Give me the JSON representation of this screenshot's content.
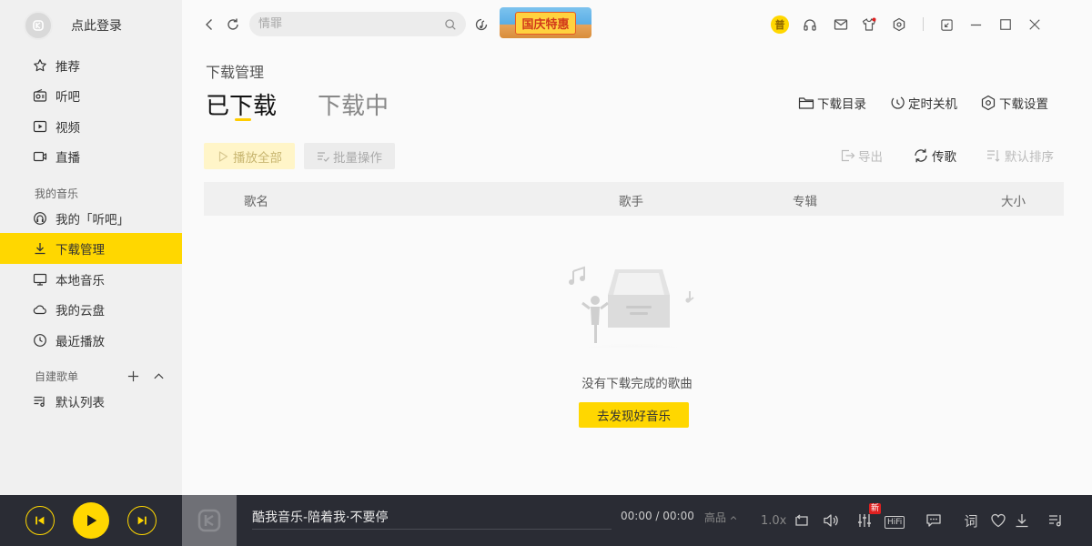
{
  "sidebar": {
    "login_text": "点此登录",
    "nav": [
      {
        "label": "推荐",
        "icon": "star-icon"
      },
      {
        "label": "听吧",
        "icon": "radio-icon"
      },
      {
        "label": "视频",
        "icon": "video-icon"
      },
      {
        "label": "直播",
        "icon": "camera-icon"
      }
    ],
    "my_music_label": "我的音乐",
    "my_music": [
      {
        "label": "我的「听吧」",
        "icon": "headset-icon"
      },
      {
        "label": "下载管理",
        "icon": "download-icon",
        "active": true
      },
      {
        "label": "本地音乐",
        "icon": "monitor-icon"
      },
      {
        "label": "我的云盘",
        "icon": "cloud-icon"
      },
      {
        "label": "最近播放",
        "icon": "clock-icon"
      }
    ],
    "playlists_label": "自建歌单",
    "playlists": [
      {
        "label": "默认列表",
        "icon": "playlist-icon"
      }
    ]
  },
  "topbar": {
    "search_placeholder": "情罪",
    "promo_text": "国庆特惠",
    "vip_text": "普"
  },
  "main": {
    "page_title": "下载管理",
    "tabs": [
      {
        "label": "已下载",
        "active": true
      },
      {
        "label": "下载中",
        "active": false
      }
    ],
    "top_actions": [
      {
        "label": "下载目录",
        "icon": "folder-icon"
      },
      {
        "label": "定时关机",
        "icon": "timer-icon"
      },
      {
        "label": "下载设置",
        "icon": "settings-icon"
      }
    ],
    "play_all_label": "播放全部",
    "batch_label": "批量操作",
    "tools": [
      {
        "label": "导出",
        "icon": "export-icon",
        "enabled": false
      },
      {
        "label": "传歌",
        "icon": "sync-icon",
        "enabled": true
      },
      {
        "label": "默认排序",
        "icon": "sort-icon",
        "enabled": false
      }
    ],
    "columns": [
      "歌名",
      "歌手",
      "专辑",
      "大小"
    ],
    "empty_text": "没有下载完成的歌曲",
    "discover_label": "去发现好音乐"
  },
  "player": {
    "track_title": "酷我音乐-陪着我·不要停",
    "time": "00:00 / 00:00",
    "quality": "高品",
    "speed": "1.0x",
    "new_badge": "新",
    "hifi_label": "HiFi",
    "lyrics_label": "词",
    "accent": "#ffd700"
  }
}
